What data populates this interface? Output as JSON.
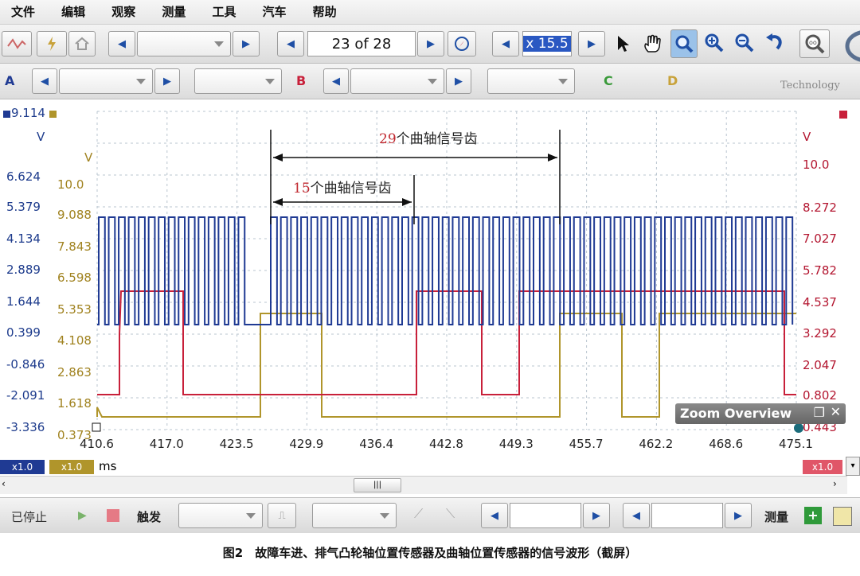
{
  "menu": [
    "文件",
    "编辑",
    "观察",
    "测量",
    "工具",
    "汽车",
    "帮助"
  ],
  "toolbar1": {
    "page_indicator": "23 of 28",
    "zoom_value": "x 15.5"
  },
  "toolbar2": {
    "channels": [
      "A",
      "B",
      "C",
      "D"
    ]
  },
  "chart_labels": {
    "top_left_value": "9.114",
    "unit_left": "V",
    "unit_mid": "V",
    "unit_right": "V",
    "left_axis": [
      "6.624",
      "5.379",
      "4.134",
      "2.889",
      "1.644",
      "0.399",
      "-0.846",
      "-2.091",
      "-3.336"
    ],
    "mid_axis": [
      "10.0",
      "9.088",
      "7.843",
      "6.598",
      "5.353",
      "4.108",
      "2.863",
      "1.618",
      "0.373"
    ],
    "right_axis": [
      "10.0",
      "8.272",
      "7.027",
      "5.782",
      "4.537",
      "3.292",
      "2.047",
      "0.802",
      "0.443"
    ],
    "x_axis": [
      "410.6",
      "417.0",
      "423.5",
      "429.9",
      "436.4",
      "442.8",
      "449.3",
      "455.7",
      "462.2",
      "468.6",
      "475.1"
    ],
    "x_unit": "ms",
    "scale_blue": "x1.0",
    "scale_gold": "x1.0",
    "scale_red": "x1.0",
    "annotation_29_num": "29",
    "annotation_29_text": "个曲轴信号齿",
    "annotation_15_num": "15",
    "annotation_15_text": "个曲轴信号齿"
  },
  "zoom_overview": {
    "title": "Zoom Overview"
  },
  "logo_text": "Technology",
  "statusbar": {
    "stopped": "已停止",
    "trigger": "触发",
    "measure": "测量"
  },
  "caption": "图2　故障车进、排气凸轮轴位置传感器及曲轴位置传感器的信号波形（截屏）",
  "colors": {
    "blue": "#1f3a93",
    "red": "#c8203a",
    "gold": "#b0952b"
  }
}
